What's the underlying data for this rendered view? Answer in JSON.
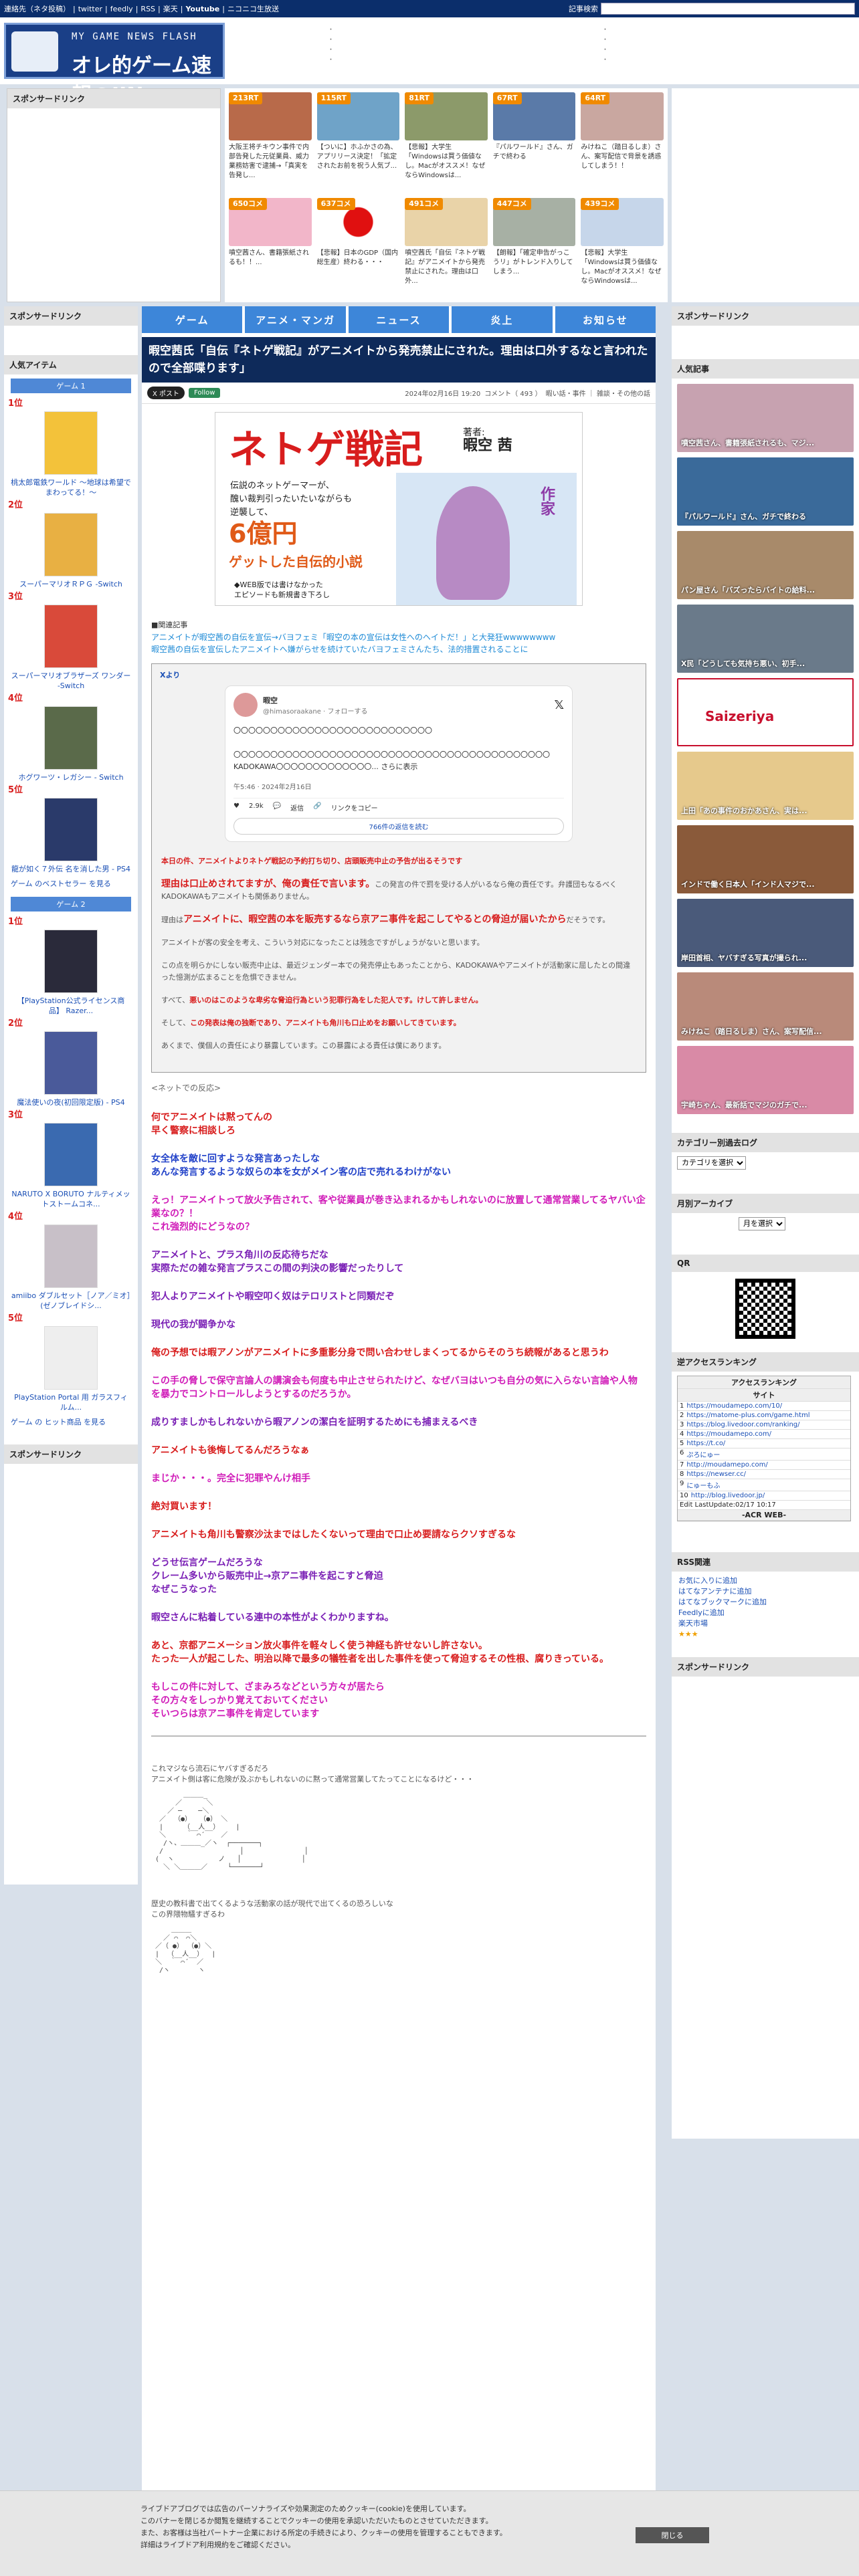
{
  "topbar": {
    "links": [
      "連絡先（ネタ投稿）",
      "twitter",
      "feedly",
      "RSS",
      "楽天",
      "Youtube",
      "ニコニコ生放送"
    ],
    "search_label": "記事検索",
    "search_placeholder": ""
  },
  "logo": {
    "line1": "MY GAME NEWS FLASH",
    "line2": "オレ的ゲーム速報@JIN"
  },
  "header_links": {
    "col1": [
      "・",
      "・",
      "・",
      "・"
    ],
    "col2": [
      "・",
      "・",
      "・",
      "・"
    ]
  },
  "sponsor_label": "スポンサードリンク",
  "feed": [
    {
      "badge": "213RT",
      "text": "大阪王将チキウン事件で内部告発した元従業員、威力業務妨害で逮捕→「真実を告発し..."
    },
    {
      "badge": "115RT",
      "text": "【ついに】ホふかさの為、アプリリース決定！「拡定されたお前を祝う人気ブ..."
    },
    {
      "badge": "81RT",
      "text": "【悲報】大学生「Windowsは買う価値なし。Macがオススメ！なぜならWindowsは..."
    },
    {
      "badge": "67RT",
      "text": "『パルワールド』さん、ガチで終わる"
    },
    {
      "badge": "64RT",
      "text": "みけねこ（踏日るしま）さん、案写配信で背景を誘惑してしまう！！"
    },
    {
      "badge": "650コメ",
      "text": "噴空茜さん、書籍張紙されるも！！..."
    },
    {
      "badge": "637コメ",
      "text": "【悲報】日本のGDP（国内総生産）終わる・・・"
    },
    {
      "badge": "491コメ",
      "text": "噴空茜氏「自伝『ネトゲ戦記』がアニメイトから発売禁止にされた。理由は口外..."
    },
    {
      "badge": "447コメ",
      "text": "【朗報】「確定申告がっこうリ」がトレンド入りしてしまう..."
    },
    {
      "badge": "439コメ",
      "text": "【悲報】大学生「Windowsは買う価値なし。Macがオススメ！なぜならWindowsは..."
    }
  ],
  "nav": [
    "ゲーム",
    "アニメ・マンガ",
    "ニュース",
    "炎上",
    "お知らせ"
  ],
  "article": {
    "title": "暇空茜氏「自伝『ネトゲ戦記』がアニメイトから発売禁止にされた。理由は口外するなと言われたので全部喋ります」",
    "x_label": "X ポスト",
    "follow_label": "Follow",
    "date": "2024年02月16日 19:20",
    "comments": "コメント（ 493 ）",
    "categories": "暇い話・事件 ｜ 雑談・その他の話",
    "banner": {
      "title": "ネトゲ戦記",
      "author_label": "著者:",
      "author": "暇空 茜",
      "sub1": "伝説のネットゲーマーが、",
      "sub2": "醜い裁判引ったいたいながらも",
      "sub3": "逆襲して、",
      "money": "6億円",
      "money2": "ゲットした自伝的小説",
      "note1": "◆WEB版では書けなかった",
      "note2": "エピソードも新規書き下ろし",
      "sakka": "作家"
    },
    "related_label": "■関連記事",
    "related": [
      "アニメイトが暇空茜の自伝を宣伝→バヨフェミ「暇空の本の宣伝は女性へのヘイトだ！」と大発狂wwwwwwww",
      "暇空茜の自伝を宣伝したアニメイトへ嫌がらせを続けていたバヨフェミさんたち、法的措置されることに"
    ],
    "x_source_label": "Xより",
    "tweet": {
      "name": "暇空",
      "handle": "@himasoraakane · フォローする",
      "line1": "〇〇〇〇〇〇〇〇〇〇〇〇〇〇〇〇〇〇〇〇〇〇〇〇〇〇〇",
      "line2": "〇〇〇〇〇〇〇〇〇〇〇〇〇〇〇〇〇〇〇〇〇〇〇〇〇〇〇〇〇〇〇〇〇〇〇〇〇〇〇〇〇〇〇",
      "line3": "KADOKAWA〇〇〇〇〇〇〇〇〇〇〇〇〇... さらに表示",
      "time": "午5:46 · 2024年2月16日",
      "likes": "2.9k",
      "reply": "返信",
      "copy": "リンクをコピー",
      "more": "766件の返信を読む"
    },
    "stmt": [
      "本日の件、アニメイトよりネトゲ戦記の予約打ち切り、店頭販売中止の予告が出るそうです",
      "理由は口止めされてますが、俺の責任で言います。",
      "この発言の件で罰を受ける人がいるなら俺の責任です。弁護団もなるべくKADOKAWAもアニメイトも関係ありません。",
      "理由は",
      "アニメイトに、暇空茜の本を販売するなら京アニ事件を起こしてやるとの脅迫が届いたから",
      "だそうです。",
      "アニメイトが客の安全を考え、こういう対応になったことは残念ですがしょうがないと思います。",
      "この点を明らかにしない販売中止は、最近ジェンダー本での発売停止もあったことから、KADOKAWAやアニメイトが活動家に屈したとの間違った憶測が広まることを危惧できません。",
      "すべて、",
      "悪いのはこのような卑劣な脅迫行為という犯罪行為をした犯人です。けして許しません。",
      "そして、",
      "この発表は俺の独断であり、アニメイトも角川も口止めをお願いしてきています。",
      "あくまで、僕個人の責任により暴露しています。この暴露による責任は僕にあります。"
    ],
    "reacts_label": "<ネットでの反応>",
    "reacts": [
      {
        "t": "何でアニメイトは黙ってんの\n早く警察に相談しろ",
        "c": "c-red"
      },
      {
        "t": "女全体を敵に回すような発言あったしな\nあんな発言するような奴らの本を女がメイン客の店で売れるわけがない",
        "c": "c-blue"
      },
      {
        "t": "えっ！アニメイトって放火予告されて、客や従業員が巻き込まれるかもしれないのに放置して通常営業してるヤバい企業なの？！\nこれ強烈的にどうなの？",
        "c": "c-mag"
      },
      {
        "t": "アニメイトと、プラス角川の反応待ちだな\n実際ただの雑な発言プラスこの間の判決の影響だったりして",
        "c": "c-pur"
      },
      {
        "t": "犯人よりアニメイトや暇空叩く奴はテロリストと同類だぞ",
        "c": "c-pur"
      },
      {
        "t": "現代の我が闘争かな",
        "c": "c-pur"
      },
      {
        "t": "俺の予想では暇アノンがアニメイトに多重影分身で問い合わせしまくってるからそのうち続報があると思うわ",
        "c": "c-red"
      },
      {
        "t": "この手の脅しで保守言論人の講演会も何度も中止させられたけど、なぜバヨはいつも自分の気に入らない言論や人物を暴力でコントロールしようとするのだろうか。",
        "c": "c-mag"
      },
      {
        "t": "成りすましかもしれないから暇アノンの潔白を証明するためにも捕まえるべき",
        "c": "c-pur"
      },
      {
        "t": "アニメイトも後悔してるんだろうなぁ",
        "c": "c-red"
      },
      {
        "t": "まじか・・・。完全に犯罪やんけ相手",
        "c": "c-mag"
      },
      {
        "t": "絶対買います！",
        "c": "c-red"
      },
      {
        "t": "アニメイトも角川も警察沙汰まではしたくないって理由で口止め要請ならクソすぎるな",
        "c": "c-red"
      },
      {
        "t": "どうせ伝言ゲームだろうな\nクレーム多いから販売中止→京アニ事件を起こすと脅迫\nなぜこうなった",
        "c": "c-pur"
      },
      {
        "t": "暇空さんに粘着している連中の本性がよくわかりますね。",
        "c": "c-pur"
      },
      {
        "t": "あと、京都アニメーション放火事件を軽々しく使う神経も許せないし許さない。\nたった一人が起こした、明治以降で最多の犠牲者を出した事件を使って脅迫するその性根、腐りきっている。",
        "c": "c-red"
      },
      {
        "t": "もしこの件に対して、ざまみろなどという方々が居たら\nその方々をしっかり覚えておいてください\nそいつらは京アニ事件を肯定しています",
        "c": "c-mag"
      }
    ],
    "aa1_text1": "これマジなら流石にヤバすぎるだろ",
    "aa1_text2": "アニメイト側は客に危険が及ぶかもしれないのに黙って通常営業してたってことになるけど・・・",
    "aa1_art": "        ＿＿＿_\n      ／      ＼\n    ／ ─    ─＼\n  ／  （●）  （●） ＼\n  |     （__人__）    |\n  ＼     ｀ ⌒´    ／\n   /ヽ、＿＿＿_／ヽ  ┌───────┐\n  /                   │               │\n (  ヽ           ノ   │               │\n   ＼ ＼＿＿＿／     └───────┘",
    "aa2_text1": "歴史の教科書で出てくるような活動家の話が現代で出てくるの恐ろしいな",
    "aa2_text2": "この界隈物騒すぎるわ",
    "aa2_art": "     ＿＿＿\n   ／ ⌒  ⌒＼\n ／（ ●） （●）＼\n |  （__人__）  |\n ＼  ｀ ⌒´  ／\n  /ヽ       ヽ"
  },
  "left": {
    "sponsor": "スポンサードリンク",
    "popular_label": "人気アイテム",
    "game1": "ゲーム 1",
    "game1_items": [
      {
        "rank": "1位",
        "title": "桃太郎電鉄ワールド ～地球は希望でまわってる！～"
      },
      {
        "rank": "2位",
        "title": "スーパーマリオＲＰＧ -Switch"
      },
      {
        "rank": "3位",
        "title": "スーパーマリオブラザーズ ワンダー -Switch"
      },
      {
        "rank": "4位",
        "title": "ホグワーツ・レガシー - Switch"
      },
      {
        "rank": "5位",
        "title": "龍が如く７外伝 名を消した男 - PS4"
      }
    ],
    "game1_more": "ゲーム のベストセラー を見る",
    "game2": "ゲーム 2",
    "game2_items": [
      {
        "rank": "1位",
        "title": "【PlayStation公式ライセンス商品】 Razer..."
      },
      {
        "rank": "2位",
        "title": "魔法使いの夜(初回限定版) - PS4"
      },
      {
        "rank": "3位",
        "title": "NARUTO X BORUTO ナルティメットストームコネ..."
      },
      {
        "rank": "4位",
        "title": "amiibo ダブルセット［ノア／ミオ］(ゼノブレイドシ..."
      },
      {
        "rank": "5位",
        "title": "PlayStation Portal 用 ガラスフィルム..."
      }
    ],
    "game2_more": "ゲーム の ヒット商品 を見る",
    "sponsor2": "スポンサードリンク"
  },
  "right": {
    "sponsor": "スポンサードリンク",
    "popular_label": "人気記事",
    "popular": [
      "噴空茜さん、書籍張紙されるも、マジ...",
      "『パルワールド』さん、ガチで終わる",
      "パン屋さん「バズったらバイトの給料...",
      "X民「どうしても気持ち悪い、初手...",
      " ",
      "上田「あの事件のおかあさん、実は...",
      "インドで働く日本人「インド人マジで...",
      "岸田首相、ヤバすぎる写真が撮られ...",
      "みけねこ（踏日るしま）さん、案写配信...",
      "宇崎ちゃん、最新話でマジのガチで..."
    ],
    "category_label": "カテゴリー別過去ログ",
    "category_select": "カテゴリを選択",
    "archive_label": "月別アーカイブ",
    "archive_select": "月を選択",
    "qr_label": "QR",
    "ranking_label": "逆アクセスランキング",
    "ranking_head": "アクセスランキング",
    "ranking_site": "サイト",
    "ranking": [
      "https://moudamepo.com/10/",
      "https://matome-plus.com/game.html",
      "https://blog.livedoor.com/ranking/",
      "https://moudamepo.com/",
      "https://t.co/",
      "ぷろにゅー",
      "http://moudamepo.com/",
      "https://newser.cc/",
      "にゅーもふ",
      "http://blog.livedoor.jp/"
    ],
    "ranking_update": "Edit LastUpdate:02/17 10:17",
    "ranking_acr": "-ACR WEB-",
    "rss_label": "RSS関連",
    "rss": [
      "お気に入りに追加",
      "はてなアンテナに追加",
      "はてなブックマークに追加",
      "Feedlyに追加",
      "楽天市場"
    ],
    "sponsor2": "スポンサードリンク"
  },
  "cookie": {
    "l1": "ライブドアブログでは広告のパーソナライズや効果測定のためクッキー(cookie)を使用しています。",
    "l2": "このバナーを閉じるか閲覧を継続することでクッキーの使用を承認いただいたものとさせていただきます。",
    "l3": "また、お客様は当社パートナー企業における所定の手続きにより、クッキーの使用を管理することもできます。",
    "l4": "詳細はライブドア利用規約をご確認ください。",
    "close": "閉じる"
  },
  "colors": {
    "nav": "#3d86d9",
    "title_bg": "#0e2a5a",
    "topbar": "#0b2e6b"
  }
}
